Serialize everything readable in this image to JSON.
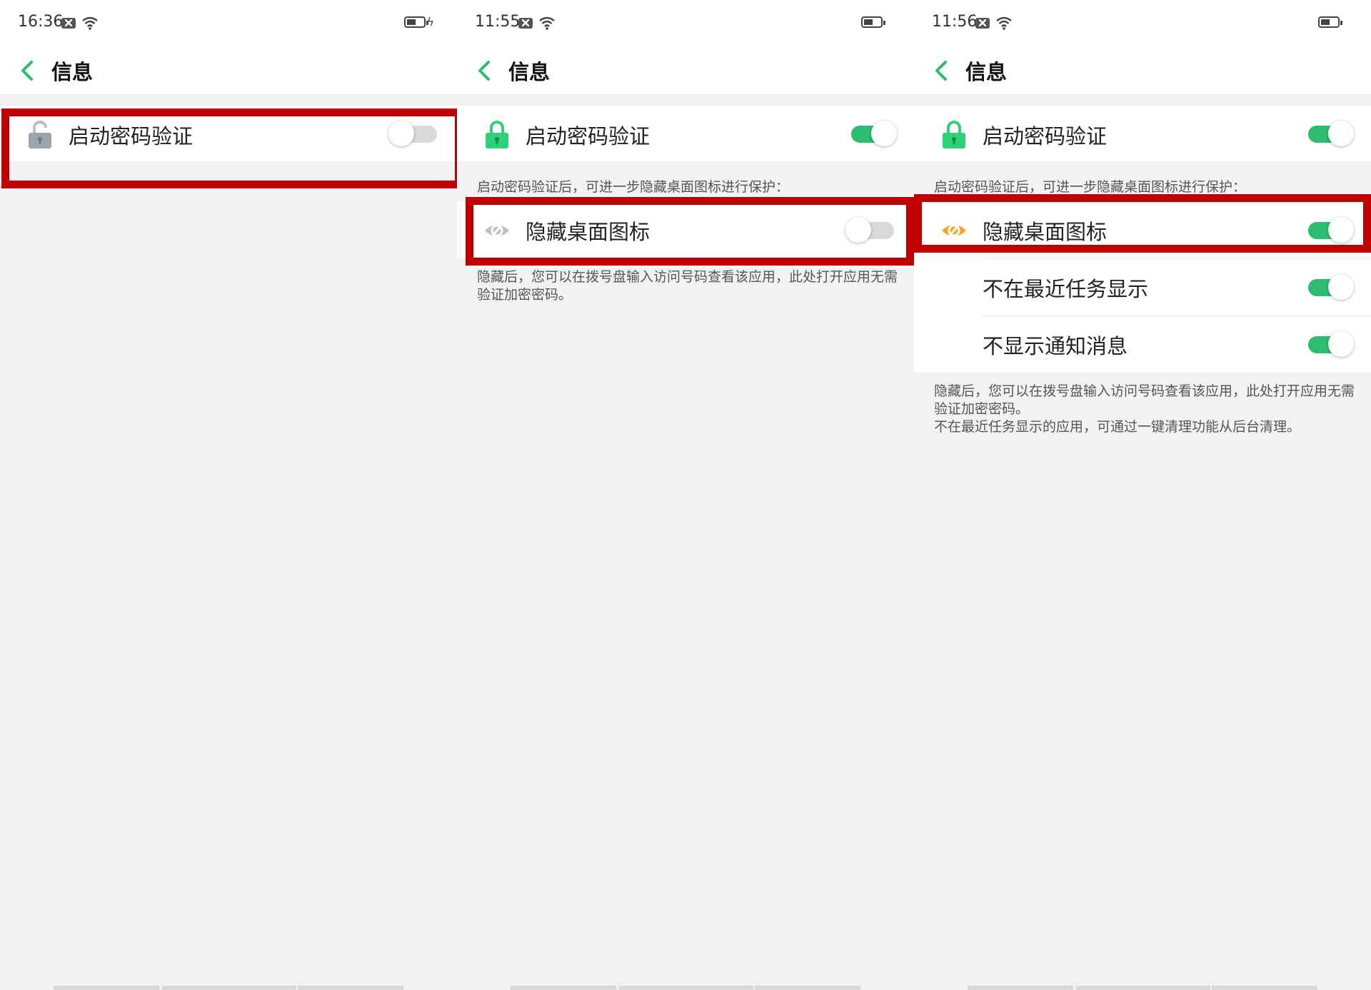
{
  "screens": [
    {
      "status_time": "16:36",
      "title": "信息",
      "password_label": "启动密码验证",
      "password_on": false
    },
    {
      "status_time": "11:55",
      "title": "信息",
      "password_label": "启动密码验证",
      "password_on": true,
      "password_note": "启动密码验证后，可进一步隐藏桌面图标进行保护：",
      "hide_icon_label": "隐藏桌面图标",
      "hide_icon_on": false,
      "hide_note": "隐藏后，您可以在拨号盘输入访问号码查看该应用，此处打开应用无需验证加密密码。"
    },
    {
      "status_time": "11:56",
      "title": "信息",
      "password_label": "启动密码验证",
      "password_on": true,
      "password_note": "启动密码验证后，可进一步隐藏桌面图标进行保护：",
      "hide_icon_label": "隐藏桌面图标",
      "hide_icon_on": true,
      "recent_tasks_label": "不在最近任务显示",
      "recent_tasks_on": true,
      "notifications_label": "不显示通知消息",
      "notifications_on": true,
      "hide_note_1": "隐藏后，您可以在拨号盘输入访问号码查看该应用，此处打开应用无需验证加密密码。",
      "hide_note_2": "不在最近任务显示的应用，可通过一键清理功能从后台清理。"
    }
  ],
  "colors": {
    "accent_green": "#2dbd71",
    "highlight_red": "#c00000",
    "icon_orange": "#f5a623",
    "icon_gray": "#9aa4ac"
  },
  "icons": [
    "back-chevron-icon",
    "lock-icon",
    "eye-slash-icon",
    "wifi-icon",
    "battery-icon",
    "mail-icon"
  ]
}
